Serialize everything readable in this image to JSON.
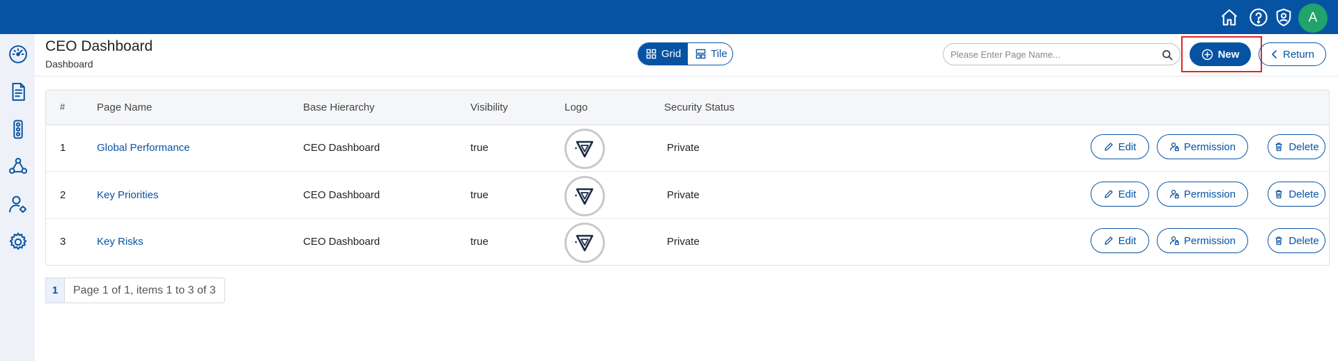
{
  "topbar": {
    "icons": [
      "home-icon",
      "help-icon",
      "shield-user-icon"
    ],
    "avatar_initial": "A"
  },
  "sidebar": {
    "icons": [
      "gauge-icon",
      "document-icon",
      "traffic-light-icon",
      "triangle-people-icon",
      "user-settings-icon",
      "gear-icon"
    ]
  },
  "header": {
    "title": "CEO Dashboard",
    "subtitle": "Dashboard"
  },
  "view_toggle": {
    "grid_label": "Grid",
    "tile_label": "Tile",
    "selected": "Grid"
  },
  "search": {
    "placeholder": "Please Enter Page Name...",
    "value": ""
  },
  "actions": {
    "new_label": "New",
    "return_label": "Return"
  },
  "table": {
    "columns": [
      "#",
      "Page Name",
      "Base Hierarchy",
      "Visibility",
      "Logo",
      "Security Status"
    ],
    "rows": [
      {
        "index": "1",
        "page_name": "Global Performance",
        "base_hierarchy": "CEO Dashboard",
        "visibility": "true",
        "security_status": "Private"
      },
      {
        "index": "2",
        "page_name": "Key Priorities",
        "base_hierarchy": "CEO Dashboard",
        "visibility": "true",
        "security_status": "Private"
      },
      {
        "index": "3",
        "page_name": "Key Risks",
        "base_hierarchy": "CEO Dashboard",
        "visibility": "true",
        "security_status": "Private"
      }
    ],
    "row_actions": {
      "edit": "Edit",
      "permission": "Permission",
      "delete": "Delete"
    }
  },
  "pagination": {
    "current_page": "1",
    "info": "Page 1 of 1, items 1 to 3 of 3"
  },
  "colors": {
    "primary": "#0653a3",
    "avatar": "#21a36b",
    "highlight": "#e02424"
  }
}
